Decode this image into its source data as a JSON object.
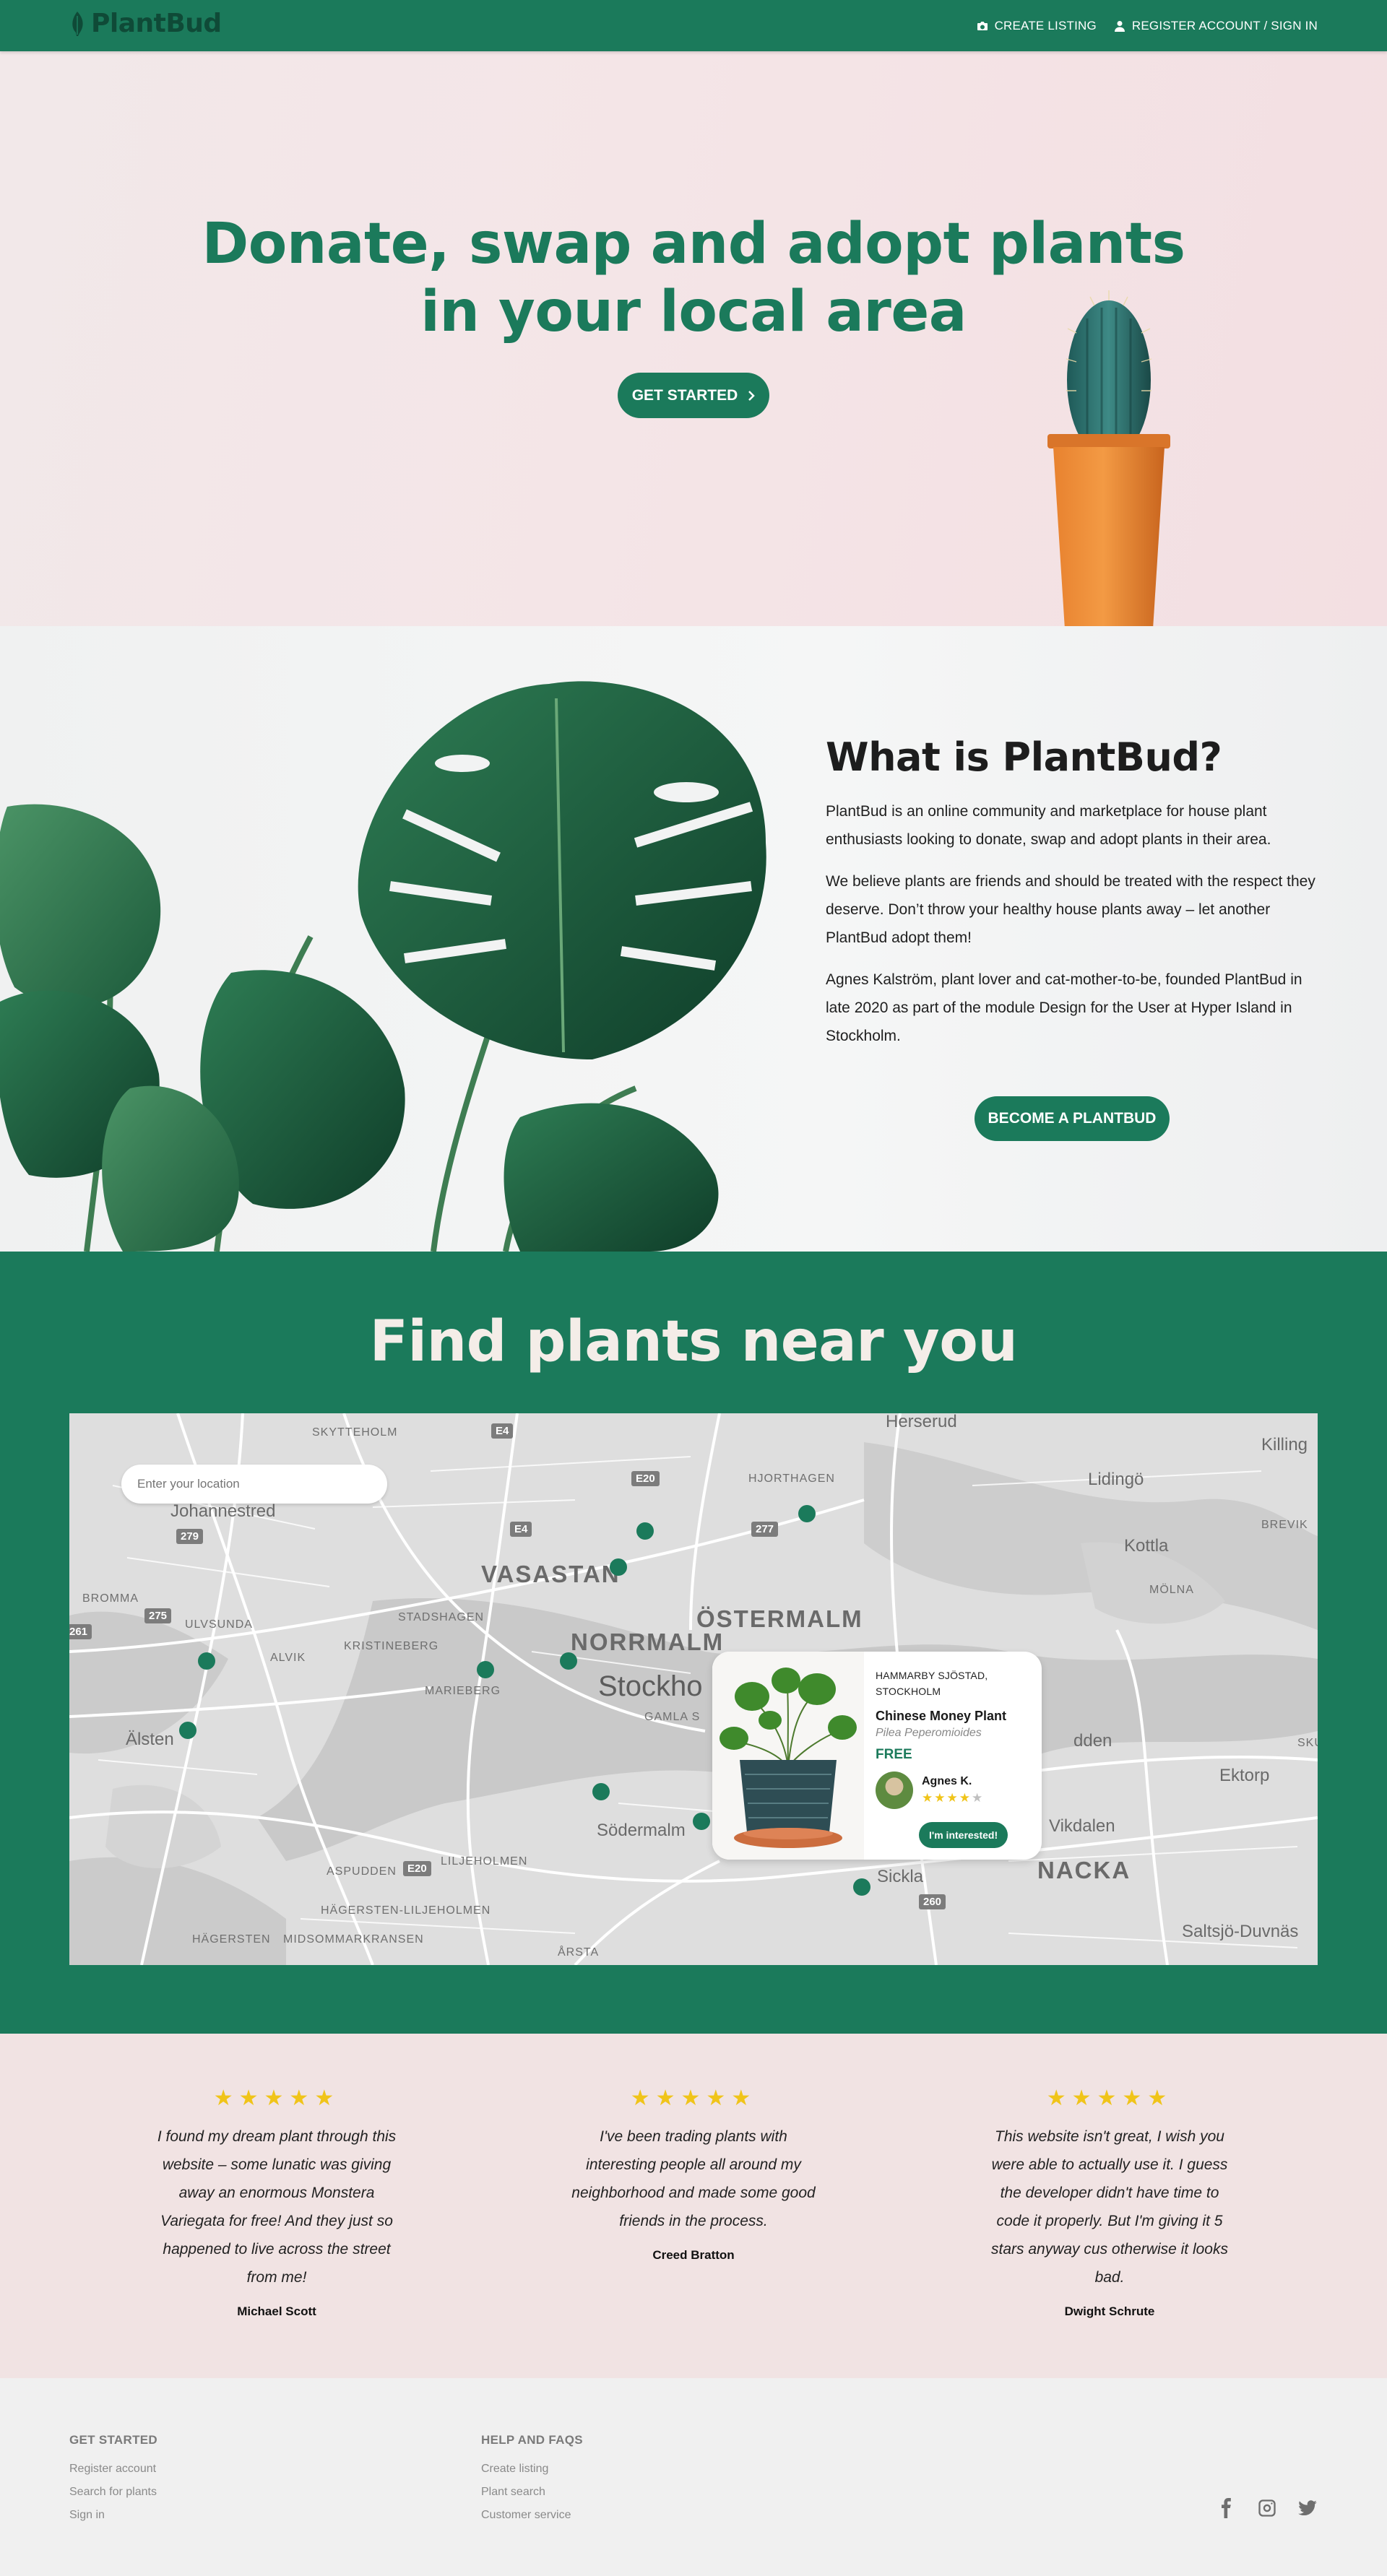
{
  "nav": {
    "brand": "PlantBud",
    "create_listing": "CREATE LISTING",
    "register": "REGISTER ACCOUNT / SIGN IN"
  },
  "hero": {
    "title_line1": "Donate, swap and adopt plants",
    "title_line2": "in your local area",
    "cta": "GET STARTED"
  },
  "about": {
    "title": "What is PlantBud?",
    "p1": "PlantBud is an online community and marketplace for house plant enthusiasts looking to donate, swap and adopt plants in their area.",
    "p2": "We believe plants are friends and should be treated with the respect they deserve. Don’t throw your healthy house plants away – let another PlantBud adopt them!",
    "p3": "Agnes Kalström, plant lover and cat-mother-to-be, founded PlantBud in late 2020 as part of the module Design for the User at Hyper Island in Stockholm.",
    "cta": "BECOME A PLANTBUD"
  },
  "find": {
    "title": "Find plants near you",
    "location_placeholder": "Enter your location",
    "map_labels": {
      "skytteholm": "SKYTTEHOLM",
      "herserud": "Herserud",
      "killinge": "Killing",
      "lidingo": "Lidingö",
      "kottla": "Kottla",
      "brevik": "BREVIK",
      "molna": "MÖLNA",
      "johannestred": "Johannestred",
      "hjorthagen": "HJORTHAGEN",
      "vasastan": "VASASTAN",
      "ostermalm": "ÖSTERMALM",
      "bromma": "BROMMA",
      "ulvsunda": "ULVSUNDA",
      "stadshagen": "STADSHAGEN",
      "alvik": "ALVIK",
      "kristineberg": "KRISTINEBERG",
      "norrmalm": "NORRMALM",
      "marieberg": "MARIEBERG",
      "stockholm": "Stockho",
      "gamla_stan": "GAMLA S",
      "alsten": "Älsten",
      "djurgarden": "dden",
      "ektorp": "Ektorp",
      "skur": "SKU",
      "sodermalm": "Södermalm",
      "vikdalen": "Vikdalen",
      "nacka": "NACKA",
      "aspudden": "ASPUDDEN",
      "liljeholmen": "LILJEHOLMEN",
      "sickla": "Sickla",
      "hagersten_lilj": "HÄGERSTEN-LILJEHOLMEN",
      "hagersten": "HÄGERSTEN",
      "midsommarkransen": "MIDSOMMARKRANSEN",
      "arsta": "ÅRSTA",
      "saltsjo": "Saltsjö-Duvnäs"
    },
    "road_shields": {
      "e4_top": "E4",
      "e20_top": "E20",
      "r277": "277",
      "r279": "279",
      "e4_mid": "E4",
      "r275": "275",
      "r261": "261",
      "e20_bot": "E20",
      "r260": "260"
    },
    "card": {
      "location": "HAMMARBY SJÖSTAD, STOCKHOLM",
      "plant_name": "Chinese Money Plant",
      "latin_name": "Pilea Peperomioides",
      "price": "FREE",
      "user": "Agnes K.",
      "user_rating": 4,
      "user_rating_max": 5,
      "cta": "I'm interested!"
    }
  },
  "reviews": [
    {
      "rating": 5,
      "text": "I found my dream plant through this website – some lunatic was giving away an enormous Monstera Variegata for free! And they just so happened to live across the street from me!",
      "author": "Michael Scott"
    },
    {
      "rating": 5,
      "text": "I've been trading plants with interesting people all around my neighborhood and made some good friends in the process.",
      "author": "Creed Bratton"
    },
    {
      "rating": 5,
      "text": "This website isn't great, I wish you were able to actually use it. I guess the developer didn't have time to code it properly. But I'm giving it 5 stars anyway cus otherwise it looks bad.",
      "author": "Dwight Schrute"
    }
  ],
  "footer": {
    "col1": {
      "heading": "GET STARTED",
      "links": [
        "Register account",
        "Search for plants",
        "Sign in"
      ]
    },
    "col2": {
      "heading": "HELP AND FAQS",
      "links": [
        "Create listing",
        "Plant search",
        "Customer service"
      ]
    },
    "social": [
      "facebook-icon",
      "instagram-icon",
      "twitter-icon"
    ]
  },
  "colors": {
    "brand_green": "#1b7a5b",
    "hero_pink": "#f3e4e6",
    "star_yellow": "#f0c419",
    "review_bg": "#f1e3e3"
  }
}
